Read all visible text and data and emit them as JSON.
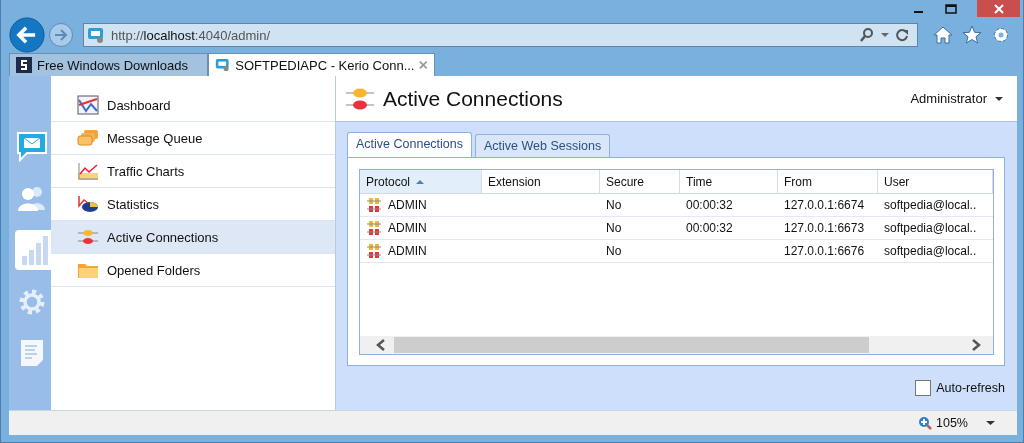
{
  "browser": {
    "address": "http://**localhost**:4040/admin/",
    "tabs": [
      {
        "title": "Free Windows Downloads",
        "kind": "site",
        "selected": false
      },
      {
        "title": "SOFTPEDIAPC - Kerio Conn...",
        "kind": "app",
        "selected": true
      }
    ]
  },
  "rail": [
    {
      "kind": "messaging",
      "selected": false
    },
    {
      "kind": "users",
      "selected": false
    },
    {
      "kind": "status",
      "selected": true
    },
    {
      "kind": "settings",
      "selected": false
    },
    {
      "kind": "logs",
      "selected": false
    }
  ],
  "menu": [
    {
      "label": "Dashboard",
      "kind": "dashboard",
      "selected": false
    },
    {
      "label": "Message Queue",
      "kind": "queue",
      "selected": false
    },
    {
      "label": "Traffic Charts",
      "kind": "charts",
      "selected": false
    },
    {
      "label": "Statistics",
      "kind": "stats",
      "selected": false
    },
    {
      "label": "Active Connections",
      "kind": "connections",
      "selected": true
    },
    {
      "label": "Opened Folders",
      "kind": "folder",
      "selected": false
    }
  ],
  "header": {
    "title": "Active Connections",
    "user": "Administrator"
  },
  "tabs": [
    {
      "label": "Active Connections",
      "selected": true
    },
    {
      "label": "Active Web Sessions",
      "selected": false
    }
  ],
  "table": {
    "columns": [
      {
        "label": "Protocol",
        "sorted": true
      },
      {
        "label": "Extension",
        "sorted": false
      },
      {
        "label": "Secure",
        "sorted": false
      },
      {
        "label": "Time",
        "sorted": false
      },
      {
        "label": "From",
        "sorted": false
      },
      {
        "label": "User",
        "sorted": false
      }
    ],
    "rows": [
      [
        "ADMIN",
        "",
        "No",
        "00:00:32",
        "127.0.0.1:6674",
        "softpedia@local.."
      ],
      [
        "ADMIN",
        "",
        "No",
        "00:00:32",
        "127.0.0.1:6673",
        "softpedia@local.."
      ],
      [
        "ADMIN",
        "",
        "No",
        "",
        "127.0.0.1:6676",
        "softpedia@local.."
      ]
    ]
  },
  "auto_refresh": {
    "label": "Auto-refresh",
    "checked": false
  },
  "status_bar": {
    "zoom": "105%"
  }
}
